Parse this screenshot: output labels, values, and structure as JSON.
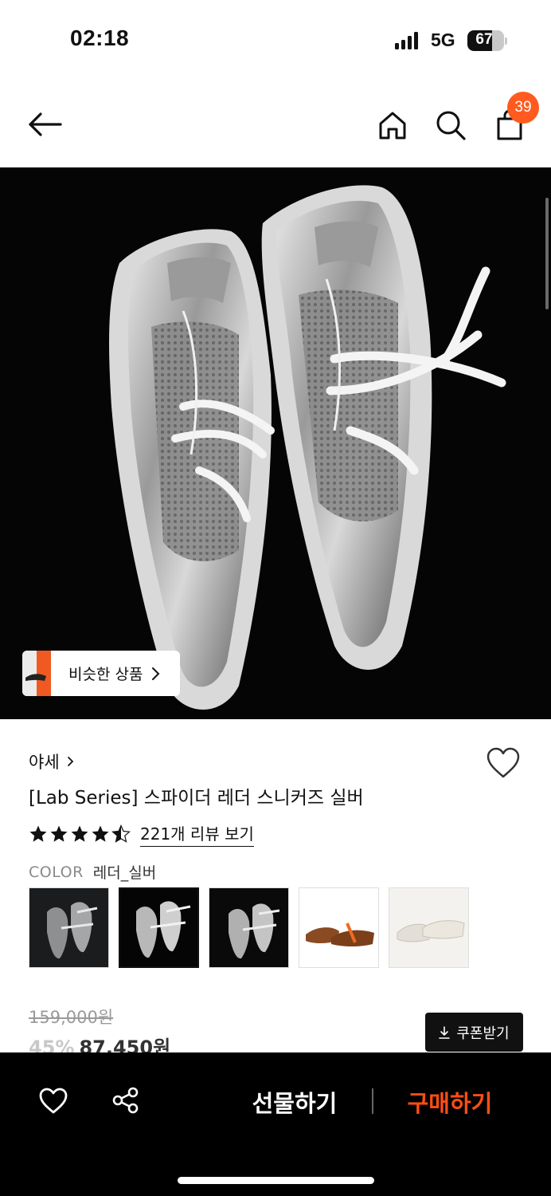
{
  "status_bar": {
    "time": "02:18",
    "network": "5G",
    "battery": "67",
    "battery_level": 0.67
  },
  "nav": {
    "icons": [
      "back-arrow-icon",
      "home-icon",
      "search-icon",
      "shopping-bag-icon"
    ],
    "cart_count": "39"
  },
  "hero": {
    "image": "silver-leather-sneakers-photo",
    "similar_label": "비슷한 상품"
  },
  "product": {
    "brand": "야세",
    "title": "[Lab Series] 스파이더 레더 스니커즈 실버",
    "rating": 4.5,
    "review_link": "221개 리뷰 보기",
    "color_label": "COLOR",
    "color_value": "레더_실버",
    "swatches": [
      {
        "name": "dark-silver",
        "selected": false
      },
      {
        "name": "silver",
        "selected": true
      },
      {
        "name": "silver-black",
        "selected": false
      },
      {
        "name": "brown",
        "selected": false
      },
      {
        "name": "white",
        "selected": false
      }
    ]
  },
  "price": {
    "original": "159,000원",
    "discount": "45%",
    "sale": "87,450원",
    "coupon_label": "쿠폰받기"
  },
  "bottom_bar": {
    "gift_label": "선물하기",
    "buy_label": "구매하기",
    "buy_color": "#ff4d14"
  }
}
